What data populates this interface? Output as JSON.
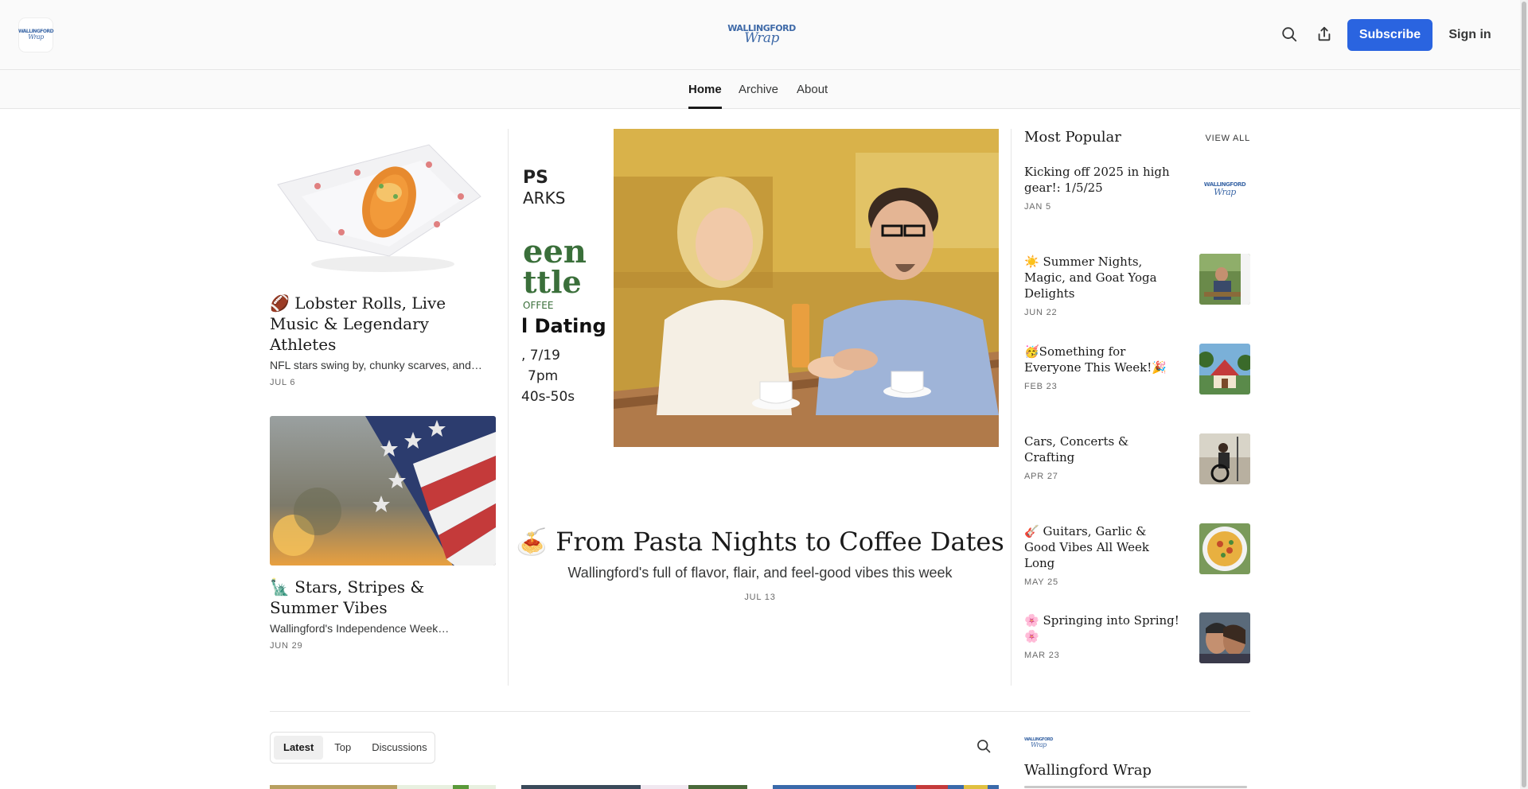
{
  "header": {
    "logo_line1": "WALLINGFORD",
    "logo_line2": "Wrap",
    "subscribe_label": "Subscribe",
    "signin_label": "Sign in",
    "icons": [
      "search-icon",
      "share-icon"
    ]
  },
  "nav": {
    "items": [
      {
        "label": "Home",
        "active": true
      },
      {
        "label": "Archive",
        "active": false
      },
      {
        "label": "About",
        "active": false
      }
    ]
  },
  "left_posts": [
    {
      "title": "🏈 Lobster Rolls, Live Music & Legendary Athletes",
      "subtitle": "NFL stars swing by, chunky scarves, and…",
      "date": "JUL 6"
    },
    {
      "title": "🗽 Stars, Stripes & Summer Vibes",
      "subtitle": "Wallingford's Independence Week…",
      "date": "JUN 29"
    }
  ],
  "hero": {
    "flyer_lines": [
      "PS",
      "ARKS",
      "een",
      "ttle",
      "OFFEE",
      "l Dating",
      ", 7/19",
      "7pm",
      "40s-50s"
    ],
    "title": "🍝 From Pasta Nights to Coffee Dates",
    "subtitle": "Wallingford's full of flavor, flair, and feel-good vibes this week",
    "date": "JUL 13"
  },
  "popular": {
    "heading": "Most Popular",
    "view_all": "VIEW ALL",
    "items": [
      {
        "title": "Kicking off 2025 in high gear!: 1/5/25",
        "date": "JAN 5"
      },
      {
        "title": "☀️ Summer Nights, Magic, and Goat Yoga Delights",
        "date": "JUN 22"
      },
      {
        "title": "🥳Something for Everyone This Week!🎉",
        "date": "FEB 23"
      },
      {
        "title": "Cars, Concerts & Crafting",
        "date": "APR 27"
      },
      {
        "title": "🎸 Guitars, Garlic & Good Vibes All Week Long",
        "date": "MAY 25"
      },
      {
        "title": "🌸 Springing into Spring! 🌸",
        "date": "MAR 23"
      }
    ]
  },
  "tabs": [
    {
      "label": "Latest",
      "active": true
    },
    {
      "label": "Top",
      "active": false
    },
    {
      "label": "Discussions",
      "active": false
    }
  ],
  "publication": {
    "name": "Wallingford Wrap"
  },
  "colors": {
    "accent": "#2a64e0",
    "logo_blue": "#3f6aa8"
  }
}
